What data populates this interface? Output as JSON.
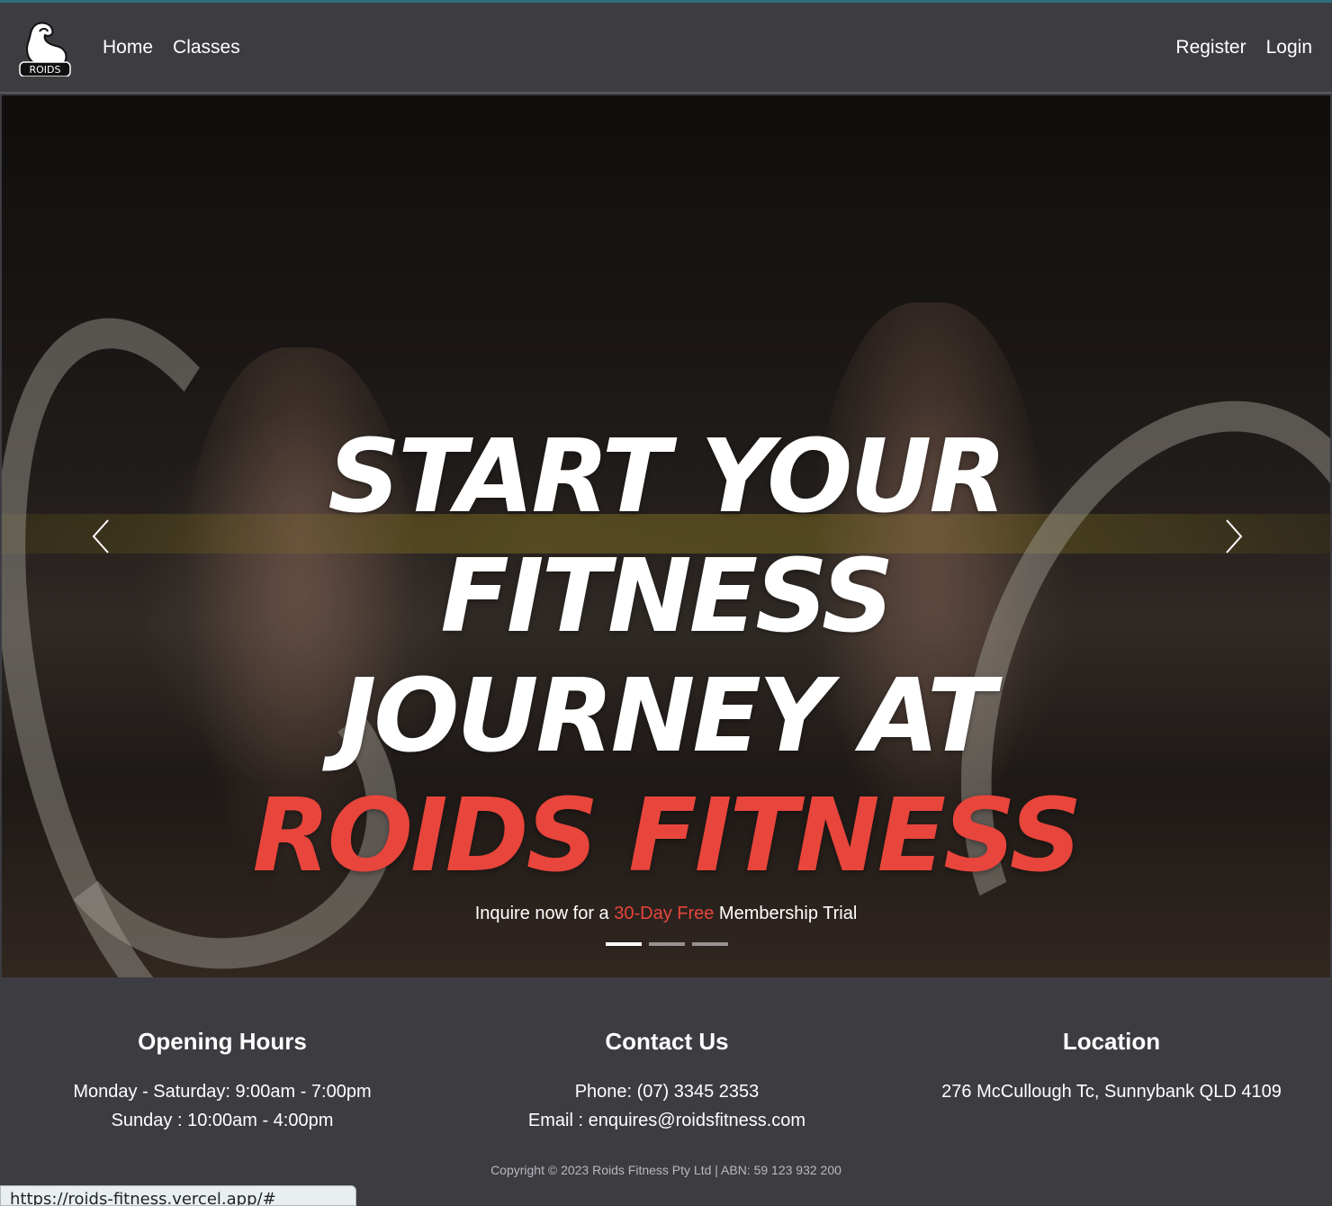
{
  "nav": {
    "logo_text": "ROIDS",
    "links_left": [
      "Home",
      "Classes"
    ],
    "links_right": [
      "Register",
      "Login"
    ]
  },
  "hero": {
    "headline_line1": "START YOUR",
    "headline_line2": "FITNESS",
    "headline_line3": "JOURNEY AT",
    "headline_accent": "ROIDS FITNESS",
    "tagline_before": "Inquire now for a ",
    "tagline_highlight": "30-Day Free",
    "tagline_after": " Membership Trial",
    "slide_count": 3,
    "active_slide": 1,
    "accent_color": "#e8453c"
  },
  "footer": {
    "hours": {
      "title": "Opening Hours",
      "line1": "Monday - Saturday: 9:00am - 7:00pm",
      "line2": "Sunday : 10:00am - 4:00pm"
    },
    "contact": {
      "title": "Contact Us",
      "phone": "Phone: (07) 3345 2353",
      "email": "Email : enquires@roidsfitness.com"
    },
    "location": {
      "title": "Location",
      "address": "276 McCullough Tc, Sunnybank QLD 4109"
    },
    "copyright": "Copyright © 2023 Roids Fitness Pty Ltd | ABN: 59 123 932 200"
  },
  "status_bar": {
    "url": "https://roids-fitness.vercel.app/#"
  }
}
